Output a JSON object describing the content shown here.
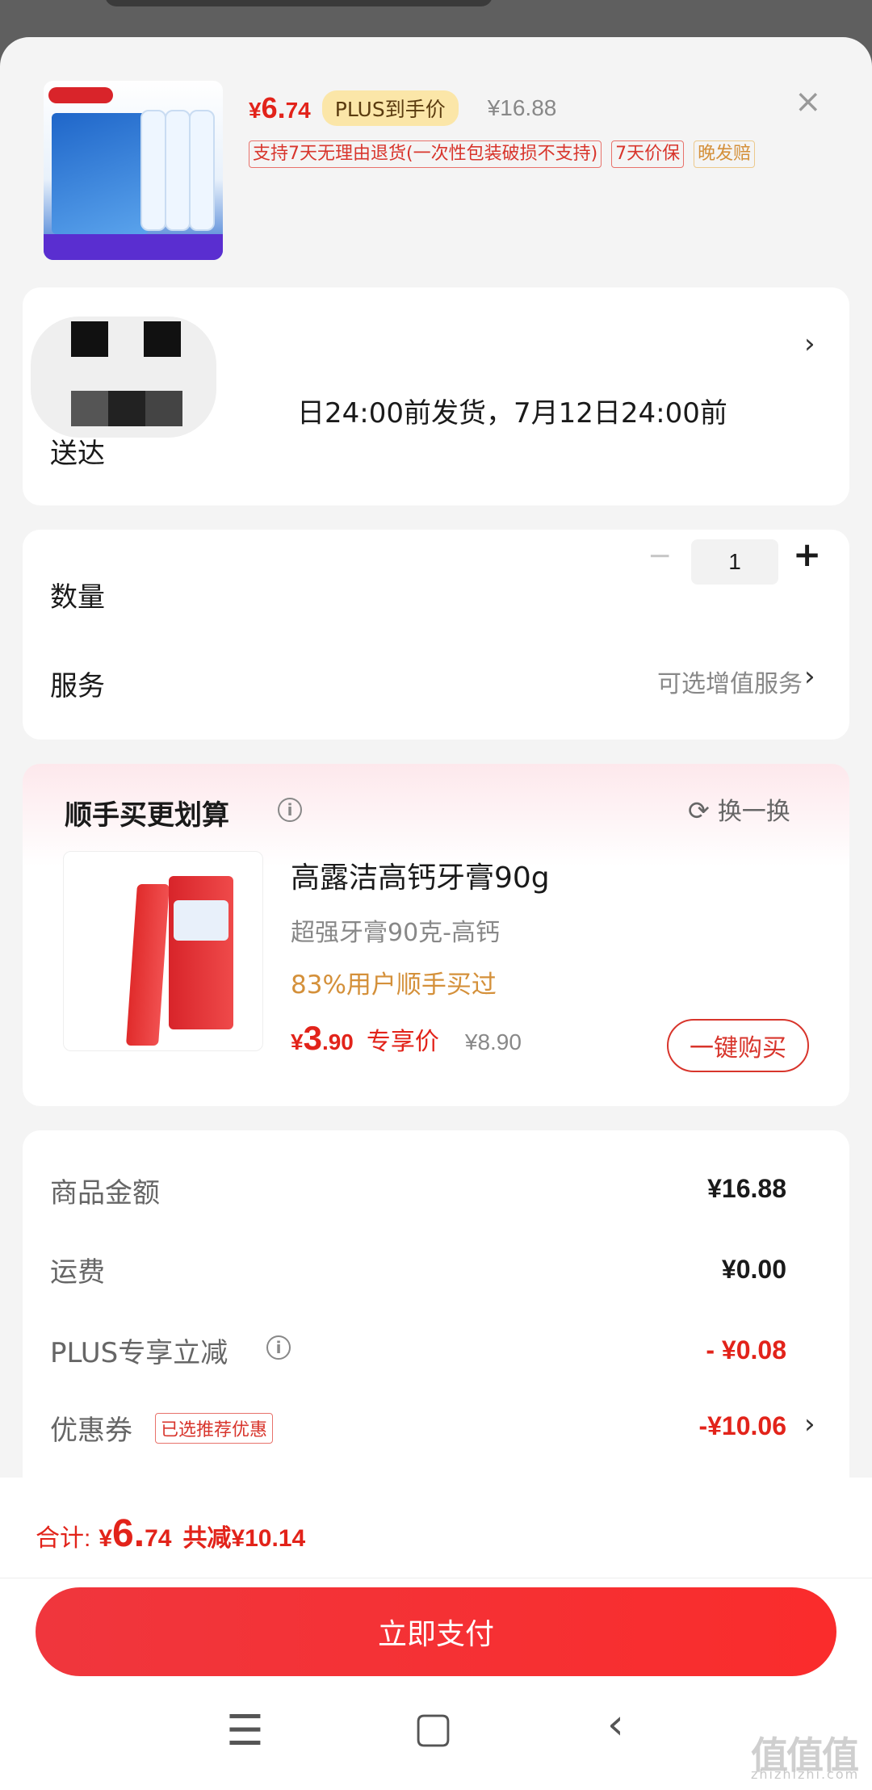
{
  "product": {
    "price_symbol": "¥",
    "price_main": "6.",
    "price_decimal": "74",
    "plus_tag": "PLUS到手价",
    "original_price": "¥16.88",
    "tags": [
      "支持7天无理由退货(一次性包装破损不支持)",
      "7天价保",
      "晚发赔"
    ],
    "image_icon": "water-bottle-pack-image"
  },
  "address": {
    "delivery_line": "日24:00前发货，7月12日24:00前",
    "delivery_line2": "送达"
  },
  "quantity": {
    "label": "数量",
    "minus": "−",
    "value": "1",
    "plus": "+"
  },
  "service": {
    "label": "服务",
    "value": "可选增值服务"
  },
  "combo": {
    "title": "顺手买更划算",
    "swap": "换一换",
    "item": {
      "name": "高露洁高钙牙膏90g",
      "subtitle": "超强牙膏90克-高钙",
      "buyers": "83%用户顺手买过",
      "price_symbol": "¥",
      "price_main": "3",
      "price_decimal": ".90",
      "exclusive": "专享价",
      "original": "¥8.90",
      "button": "一键购买"
    }
  },
  "summary": {
    "rows": [
      {
        "label": "商品金额",
        "value": "¥16.88"
      },
      {
        "label": "运费",
        "value": "¥0.00"
      },
      {
        "label": "PLUS专享立减",
        "value": "- ¥0.08"
      },
      {
        "label": "优惠券",
        "value": "-¥10.06",
        "tag": "已选推荐优惠"
      }
    ]
  },
  "bottom": {
    "total_label": "合计:",
    "total_symbol": "¥",
    "total_main": "6.",
    "total_decimal": "74",
    "saved": "共减¥10.14",
    "pay_button": "立即支付"
  },
  "watermark": {
    "text": "值值值",
    "site": "zhizhizhi.com"
  },
  "colors": {
    "accent": "#e2231a",
    "plus_tag_bg": "#fbe6a8",
    "gold": "#d4903a"
  }
}
